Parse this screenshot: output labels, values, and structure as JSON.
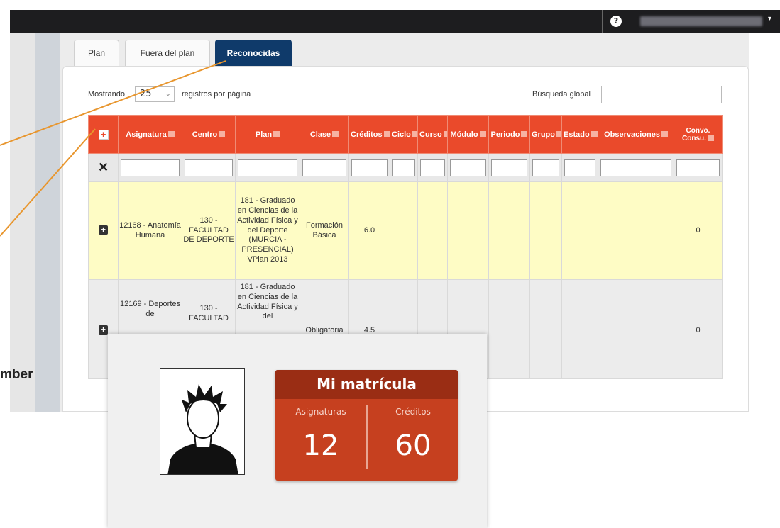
{
  "header": {
    "help_icon": "?",
    "user_caret": "▾"
  },
  "tabs": [
    {
      "label": "Plan",
      "active": false
    },
    {
      "label": "Fuera del plan",
      "active": false
    },
    {
      "label": "Reconocidas",
      "active": true
    }
  ],
  "toolbar": {
    "showing_label": "Mostrando",
    "page_size": "25",
    "page_size_suffix": "registros por página",
    "search_label": "Búsqueda global"
  },
  "table": {
    "columns": [
      "Asignatura",
      "Centro",
      "Plan",
      "Clase",
      "Créditos",
      "Ciclo",
      "Curso",
      "Módulo",
      "Periodo",
      "Grupo",
      "Estado",
      "Observaciones",
      "Convo. Consu."
    ],
    "rows": [
      {
        "asignatura": "12168 - Anatomía Humana",
        "centro": "130 - FACULTAD DE DEPORTE",
        "plan": "181 - Graduado en Ciencias de la Actividad Física y del Deporte (MURCIA - PRESENCIAL) VPlan 2013",
        "clase": "Formación Básica",
        "creditos": "6.0",
        "convo": "0"
      },
      {
        "asignatura": "12169 - Deportes de",
        "centro": "130 - FACULTAD",
        "plan": "181 - Graduado en Ciencias de la Actividad Física y del",
        "clase": "Obligatoria",
        "creditos": "4.5",
        "convo": "0"
      }
    ]
  },
  "annotation": {
    "text": "mber"
  },
  "card": {
    "title": "Mi matrícula",
    "subjects_label": "Asignaturas",
    "subjects_value": "12",
    "credits_label": "Créditos",
    "credits_value": "60"
  },
  "colors": {
    "accent": "#ea4a2b",
    "tab_active": "#0f3a6a",
    "badge": "#c6401f",
    "annotation_line": "#e8962e"
  }
}
